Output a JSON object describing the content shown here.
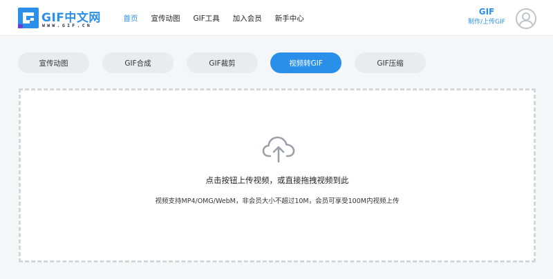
{
  "brand": {
    "name": "GIF中文网",
    "url_text": "WWW.GIF.CN",
    "color": "#2a8fe8"
  },
  "nav": [
    {
      "label": "首页",
      "active": true
    },
    {
      "label": "宣传动图",
      "active": false
    },
    {
      "label": "GIF工具",
      "active": false
    },
    {
      "label": "加入会员",
      "active": false
    },
    {
      "label": "新手中心",
      "active": false
    }
  ],
  "make_gif": {
    "title": "GIF",
    "subtitle": "制作/上传GIF"
  },
  "avatar": {
    "icon": "user-avatar-icon"
  },
  "tabs": [
    {
      "label": "宣传动图",
      "active": false
    },
    {
      "label": "GIF合成",
      "active": false
    },
    {
      "label": "GIF裁剪",
      "active": false
    },
    {
      "label": "视频转GIF",
      "active": true
    },
    {
      "label": "GIF压缩",
      "active": false
    }
  ],
  "upload": {
    "icon": "cloud-upload-icon",
    "main_text": "点击按钮上传视频，或直接拖拽视频到此",
    "sub_text": "视频支持MP4/OMG/WebM，非会员大小不超过10M，会员可享受100M内视频上传"
  }
}
